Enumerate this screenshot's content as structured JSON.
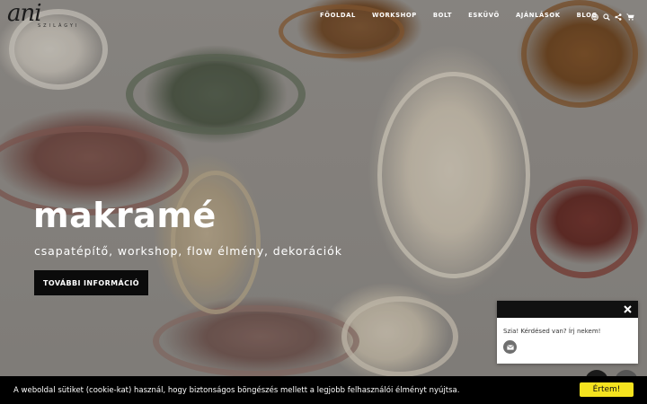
{
  "logo": {
    "word": "ani",
    "sub": "SZILÁGYI"
  },
  "nav": {
    "items": [
      {
        "label": "FŐOLDAL"
      },
      {
        "label": "WORKSHOP"
      },
      {
        "label": "BOLT"
      },
      {
        "label": "ESKÜVŐ"
      },
      {
        "label": "AJÁNLÁSOK"
      },
      {
        "label": "BLOG"
      }
    ],
    "icons": [
      "globe-icon",
      "search-icon",
      "share-icon",
      "cart-icon"
    ]
  },
  "hero": {
    "title": "makramé",
    "subtitle": "csapatépítő, workshop, flow élmény, dekorációk",
    "button": "TOVÁBBI INFORMÁCIÓ"
  },
  "chat": {
    "message": "Szia! Kérdésed van? Írj nekem!",
    "close_icon": "close-icon",
    "mail_icon": "mail-icon"
  },
  "cookie": {
    "text": "A weboldal sütiket (cookie-kat) használ, hogy biztonságos böngészés mellett a legjobb felhasználói élményt nyújtsa.",
    "button": "Értem!"
  },
  "colors": {
    "cookie_button": "#f5e31f",
    "nav_text": "#ffffff",
    "dark": "#0b0b0b"
  }
}
